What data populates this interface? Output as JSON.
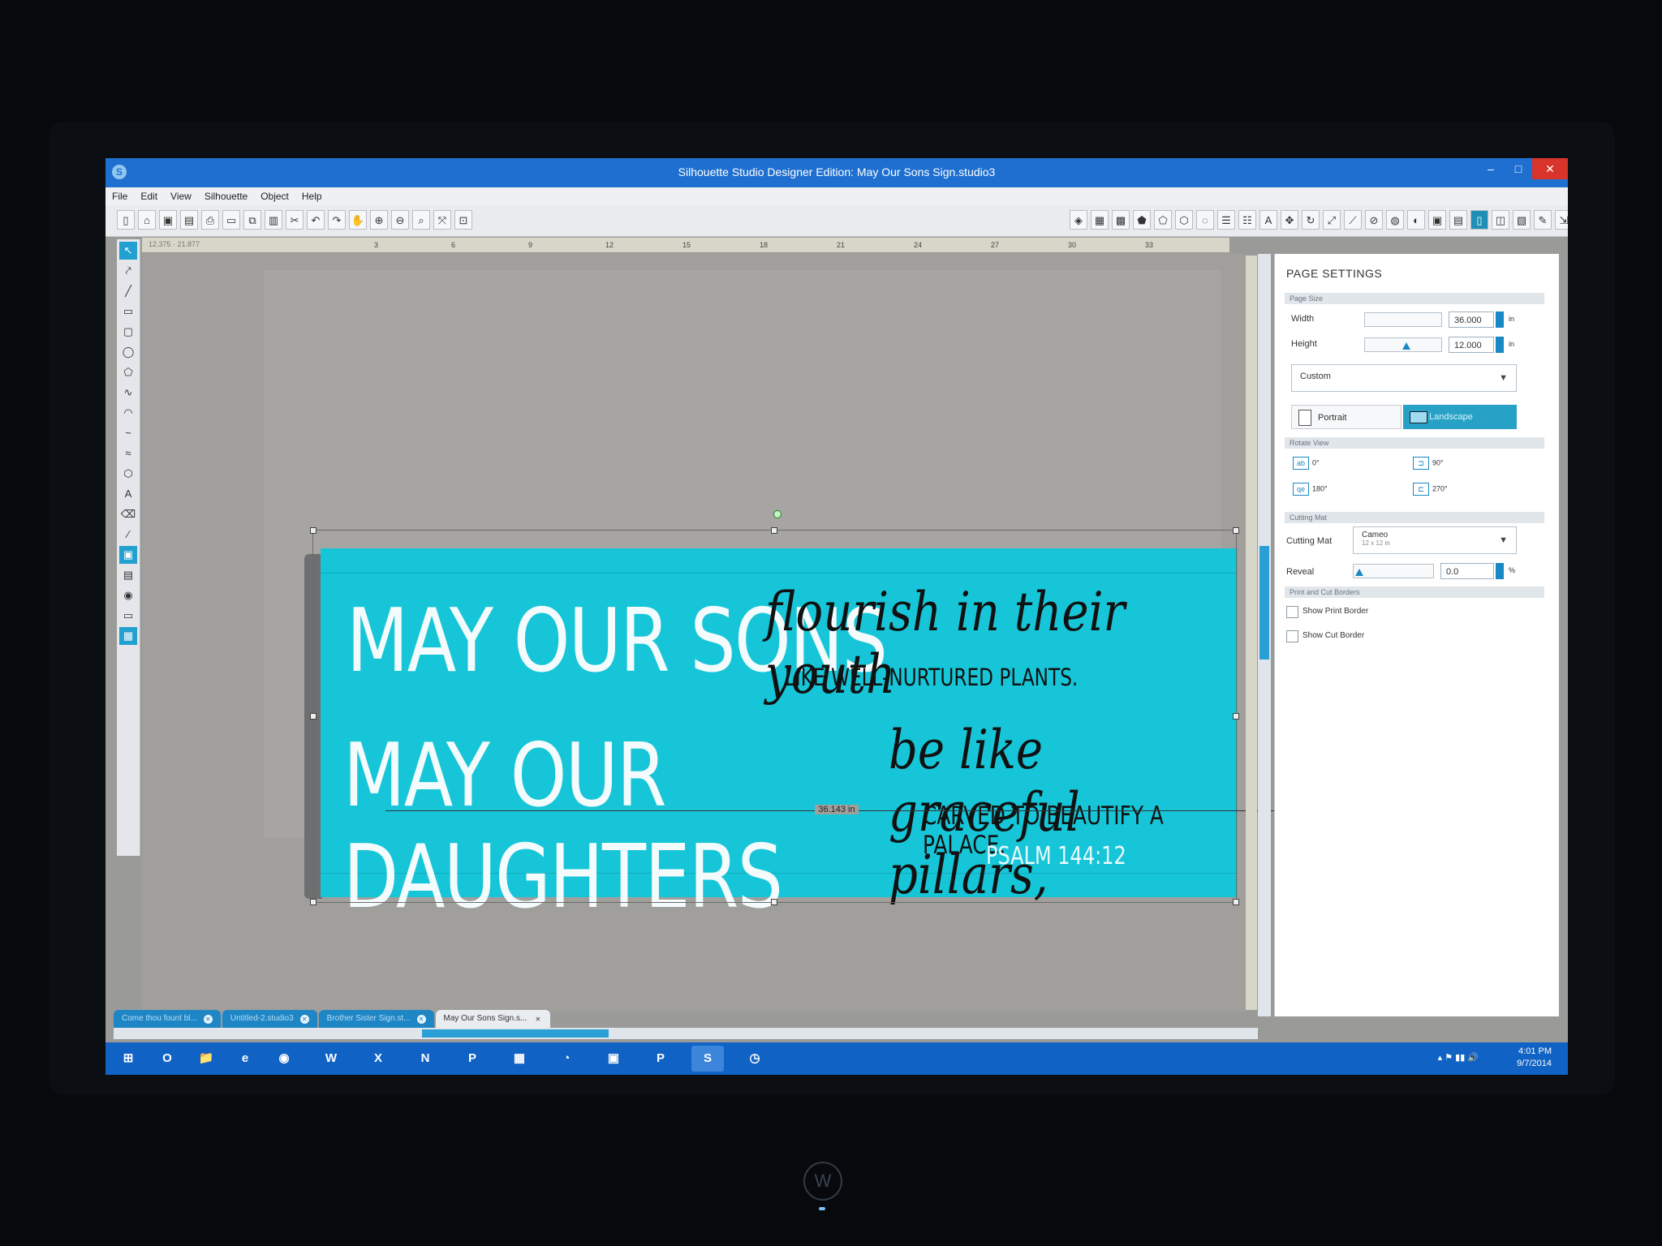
{
  "window": {
    "title": "Silhouette Studio Designer Edition: May Our Sons Sign.studio3",
    "app_icon": "S",
    "buttons": {
      "minimize": "–",
      "maximize": "□",
      "close": "✕"
    }
  },
  "menu": [
    "File",
    "Edit",
    "View",
    "Silhouette",
    "Object",
    "Help"
  ],
  "ruler": {
    "coord": "12.375 · 21.877",
    "ticks": [
      "3",
      "6",
      "9",
      "12",
      "15",
      "18",
      "21",
      "24",
      "27",
      "30",
      "33"
    ]
  },
  "design": {
    "line1_big": "MAY OUR SONS",
    "line1_script": "flourish in their youth",
    "line1_small": "LIKE WELL-NURTURED PLANTS.",
    "line2_big": "MAY OUR DAUGHTERS",
    "line2_script": "be like graceful pillars,",
    "line2_small": "CARVED TO BEAUTIFY A PALACE.",
    "reference": "PSALM 144:12",
    "background_color": "#16c6d8",
    "width_label": "36.143 in"
  },
  "panel": {
    "title": "PAGE SETTINGS",
    "page_size": {
      "header": "Page Size",
      "width_label": "Width",
      "width_value": "36.000",
      "height_label": "Height",
      "height_value": "12.000",
      "unit": "in",
      "preset": "Custom",
      "portrait": "Portrait",
      "landscape": "Landscape"
    },
    "rotate": {
      "header": "Rotate View",
      "r0": "0°",
      "r90": "90°",
      "r180": "180°",
      "r270": "270°"
    },
    "cutting_mat": {
      "header": "Cutting Mat",
      "label": "Cutting Mat",
      "value": "Cameo",
      "sub": "12 x 12 in",
      "reveal_label": "Reveal",
      "reveal_value": "0.0",
      "reveal_unit": "%"
    },
    "borders": {
      "header": "Print and Cut Borders",
      "print": "Show Print Border",
      "cut": "Show Cut Border"
    }
  },
  "tabs": [
    {
      "label": "Come thou fount bl...",
      "active": false
    },
    {
      "label": "Untitled-2.studio3",
      "active": false
    },
    {
      "label": "Brother Sister Sign.st...",
      "active": false
    },
    {
      "label": "May Our Sons Sign.s...",
      "active": true
    }
  ],
  "taskbar": {
    "time": "4:01 PM",
    "date": "9/7/2014",
    "apps": [
      "⊞",
      "O",
      "📁",
      "e",
      "◉",
      "W",
      "X",
      "N",
      "P",
      "▦",
      "◔",
      "▣",
      "P",
      "S",
      "◷"
    ]
  },
  "monitor_logo": "W"
}
